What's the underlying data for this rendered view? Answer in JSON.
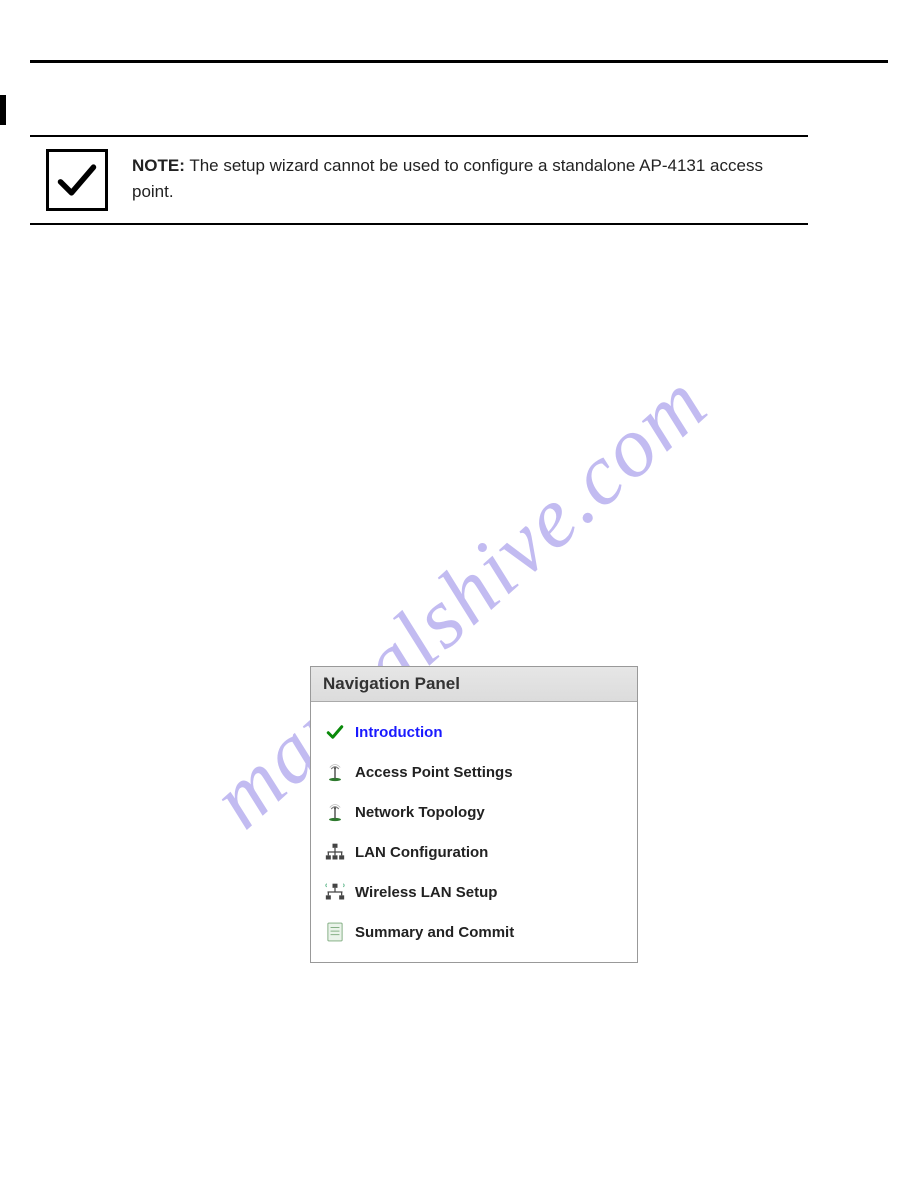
{
  "note": {
    "label": "NOTE:",
    "text": "The setup wizard cannot be used to configure a standalone AP-4131 access point."
  },
  "watermark": "manualshive.com",
  "panel": {
    "title": "Navigation Panel",
    "items": [
      {
        "label": "Introduction",
        "icon": "check-icon",
        "active": true
      },
      {
        "label": "Access Point Settings",
        "icon": "antenna-icon",
        "active": false
      },
      {
        "label": "Network Topology",
        "icon": "antenna-icon",
        "active": false
      },
      {
        "label": "LAN Configuration",
        "icon": "lan-icon",
        "active": false
      },
      {
        "label": "Wireless LAN Setup",
        "icon": "wlan-icon",
        "active": false
      },
      {
        "label": "Summary and Commit",
        "icon": "document-icon",
        "active": false
      }
    ]
  }
}
